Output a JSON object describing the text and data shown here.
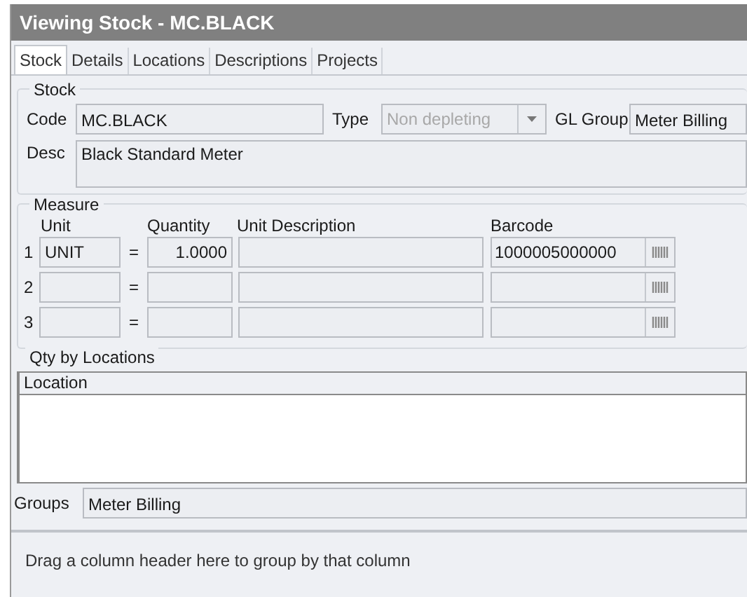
{
  "window": {
    "title": "Viewing Stock - MC.BLACK"
  },
  "tabs": [
    {
      "label": "Stock",
      "selected": true
    },
    {
      "label": "Details",
      "selected": false
    },
    {
      "label": "Locations",
      "selected": false
    },
    {
      "label": "Descriptions",
      "selected": false
    },
    {
      "label": "Projects",
      "selected": false
    }
  ],
  "stock": {
    "title": "Stock",
    "code": {
      "label": "Code",
      "value": "MC.BLACK"
    },
    "type": {
      "label": "Type",
      "value": "Non depleting",
      "disabled": true
    },
    "gl_group": {
      "label": "GL Group",
      "value": "Meter Billing"
    },
    "desc": {
      "label": "Desc",
      "value": "Black Standard Meter"
    }
  },
  "measure": {
    "title": "Measure",
    "columns": [
      "Unit",
      "Quantity",
      "Unit Description",
      "Barcode"
    ],
    "rows": [
      {
        "number": "1",
        "unit": "UNIT",
        "separator": "=",
        "quantity": "1.0000",
        "barcode": "1000005000000"
      },
      {
        "number": "2",
        "separator": "="
      },
      {
        "number": "3",
        "separator": "="
      }
    ]
  },
  "qty_by_locations": {
    "title": "Qty by Locations",
    "columns": [
      "Location"
    ]
  },
  "groups": {
    "label": "Groups",
    "value": "Meter Billing"
  },
  "group_panel": {
    "hint": "Drag a column header here to group by that column"
  }
}
